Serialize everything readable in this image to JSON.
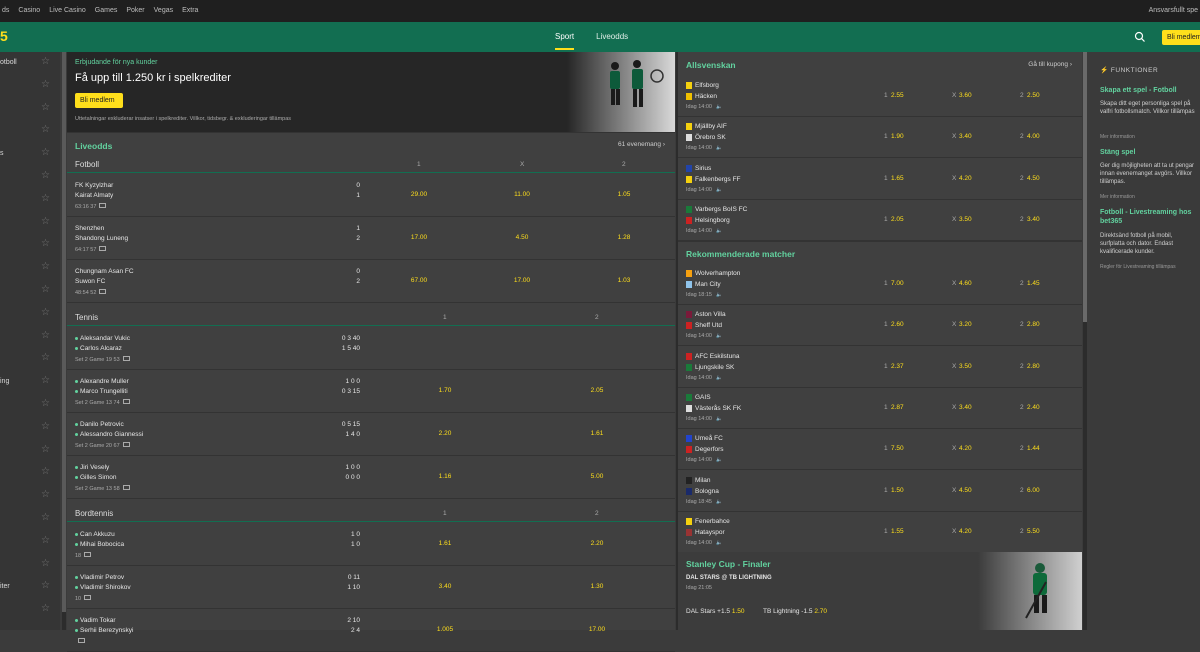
{
  "topbar": {
    "links": [
      "ds",
      "Casino",
      "Live Casino",
      "Games",
      "Poker",
      "Vegas",
      "Extra"
    ],
    "responsible": "Ansvarsfullt spe"
  },
  "header": {
    "logo": "5",
    "nav": [
      "Sport",
      "Liveodds"
    ],
    "join": "Bli medlem"
  },
  "sidebar": {
    "items": [
      "otboll",
      "",
      "",
      "",
      "s",
      "",
      "",
      "",
      "",
      "",
      "",
      "",
      "",
      "",
      "ing",
      "",
      "",
      "",
      "",
      "",
      "",
      "",
      "",
      "iter",
      ""
    ]
  },
  "promo": {
    "pre": "Erbjudande för nya kunder",
    "title": "Få upp till 1.250 kr i spelkrediter",
    "button": "Bli medlem",
    "legal": "Uttetalningar exkluderar insatser i spelkrediter. Villkor, tidsbegr. & exkluderingar tillämpas"
  },
  "liveodds": {
    "title": "Liveodds",
    "count": "61 evenemang",
    "groups": [
      {
        "name": "Fotboll",
        "cols": [
          "1",
          "X",
          "2"
        ],
        "rows": [
          {
            "t1": "FK Kyzylzhar",
            "t2": "Kairat Almaty",
            "s1": "0",
            "s2": "1",
            "meta": "63:16  37",
            "odds": [
              "29.00",
              "11.00",
              "1.05"
            ]
          },
          {
            "t1": "Shenzhen",
            "t2": "Shandong Luneng",
            "s1": "1",
            "s2": "2",
            "meta": "64:17  57",
            "odds": [
              "17.00",
              "4.50",
              "1.28"
            ]
          },
          {
            "t1": "Chungnam Asan FC",
            "t2": "Suwon FC",
            "s1": "0",
            "s2": "2",
            "meta": "48:54  52",
            "odds": [
              "67.00",
              "17.00",
              "1.03"
            ]
          }
        ]
      },
      {
        "name": "Tennis",
        "cols": [
          "1",
          "2"
        ],
        "rows": [
          {
            "t1": "Aleksandar Vukic",
            "t2": "Carlos Alcaraz",
            "s1": "0  3  40",
            "s2": "1  5  40",
            "meta": "Set 2 Game 19  53",
            "odds": [
              "",
              ""
            ]
          },
          {
            "t1": "Alexandre Muller",
            "t2": "Marco Trungelliti",
            "s1": "1  0  0",
            "s2": "0  3  15",
            "meta": "Set 2 Game 13  74",
            "odds": [
              "1.70",
              "2.05"
            ]
          },
          {
            "t1": "Danilo Petrovic",
            "t2": "Alessandro Giannessi",
            "s1": "0  5  15",
            "s2": "1  4  0",
            "meta": "Set 2 Game 20  67",
            "odds": [
              "2.20",
              "1.61"
            ]
          },
          {
            "t1": "Jiri Vesely",
            "t2": "Gilles Simon",
            "s1": "1  0  0",
            "s2": "0  0  0",
            "meta": "Set 2 Game 13  58",
            "odds": [
              "1.16",
              "5.00"
            ]
          }
        ]
      },
      {
        "name": "Bordtennis",
        "cols": [
          "1",
          "2"
        ],
        "rows": [
          {
            "t1": "Can Akkuzu",
            "t2": "Mihai Bobocica",
            "s1": "1  0",
            "s2": "1  0",
            "meta": "18",
            "odds": [
              "1.61",
              "2.20"
            ]
          },
          {
            "t1": "Vladimir Petrov",
            "t2": "Vladimir Shirokov",
            "s1": "0  11",
            "s2": "1  10",
            "meta": "10",
            "odds": [
              "3.40",
              "1.30"
            ]
          },
          {
            "t1": "Vadim Tokar",
            "t2": "Serhii Berezynskyi",
            "s1": "2  10",
            "s2": "2  4",
            "meta": "",
            "odds": [
              "1.005",
              "17.00"
            ]
          }
        ]
      }
    ]
  },
  "allsvenskan": {
    "title": "Allsvenskan",
    "link": "Gå till kupong",
    "matches": [
      {
        "t1": "Elfsborg",
        "t2": "Häcken",
        "time": "Idag 14:00",
        "k1": "#f5d10f",
        "k2": "#f0c000",
        "o": [
          "2.55",
          "3.60",
          "2.50"
        ]
      },
      {
        "t1": "Mjällby AIF",
        "t2": "Örebro SK",
        "time": "Idag 14:00",
        "k1": "#f5d10f",
        "k2": "#ddd",
        "o": [
          "1.90",
          "3.40",
          "4.00"
        ]
      },
      {
        "t1": "Sirius",
        "t2": "Falkenbergs FF",
        "time": "Idag 14:00",
        "k1": "#2244aa",
        "k2": "#f5d10f",
        "o": [
          "1.65",
          "4.20",
          "4.50"
        ]
      },
      {
        "t1": "Varbergs BoIS FC",
        "t2": "Helsingborg",
        "time": "Idag 14:00",
        "k1": "#1a7a3a",
        "k2": "#cc2222",
        "o": [
          "2.05",
          "3.50",
          "3.40"
        ]
      }
    ]
  },
  "rekommenderade": {
    "title": "Rekommenderade matcher",
    "matches": [
      {
        "t1": "Wolverhampton",
        "t2": "Man City",
        "time": "Idag 18:15",
        "k1": "#f5a010",
        "k2": "#8fc3ea",
        "o": [
          "7.00",
          "4.60",
          "1.45"
        ]
      },
      {
        "t1": "Aston Villa",
        "t2": "Sheff Utd",
        "time": "Idag 14:00",
        "k1": "#7a1a3a",
        "k2": "#cc2222",
        "o": [
          "2.60",
          "3.20",
          "2.80"
        ]
      },
      {
        "t1": "AFC Eskilstuna",
        "t2": "Ljungskile SK",
        "time": "Idag 14:00",
        "k1": "#cc2222",
        "k2": "#1a7a3a",
        "o": [
          "2.37",
          "3.50",
          "2.80"
        ]
      },
      {
        "t1": "GAIS",
        "t2": "Västerås SK FK",
        "time": "Idag 14:00",
        "k1": "#1a7a3a",
        "k2": "#ddd",
        "o": [
          "2.87",
          "3.40",
          "2.40"
        ]
      },
      {
        "t1": "Umeå FC",
        "t2": "Degerfors",
        "time": "Idag 14:00",
        "k1": "#2244cc",
        "k2": "#cc2222",
        "o": [
          "7.50",
          "4.20",
          "1.44"
        ]
      },
      {
        "t1": "Milan",
        "t2": "Bologna",
        "time": "Idag 18:45",
        "k1": "#222",
        "k2": "#1a2a6a",
        "o": [
          "1.50",
          "4.50",
          "6.00"
        ]
      },
      {
        "t1": "Fenerbahce",
        "t2": "Hatayspor",
        "time": "Idag 14:00",
        "k1": "#f5d10f",
        "k2": "#993333",
        "o": [
          "1.55",
          "4.20",
          "5.50"
        ]
      }
    ]
  },
  "stanley": {
    "title": "Stanley Cup - Finaler",
    "match": "DAL STARS @ TB LIGHTNING",
    "time": "Idag 21:05",
    "l1": "DAL Stars +1.5",
    "v1": "1.50",
    "l2": "TB Lightning -1.5",
    "v2": "2.70"
  },
  "features": {
    "heading": "FUNKTIONER",
    "items": [
      {
        "title": "Skapa ett spel - Fotboll",
        "desc": "Skapa ditt eget personliga spel på valfri fotbollsmatch. Villkor tillämpas",
        "more": "Mer information"
      },
      {
        "title": "Stäng spel",
        "desc": "Ger dig möjligheten att ta ut pengar innan evenemanget avgörs. Villkor tillämpas.",
        "more": "Mer information"
      },
      {
        "title": "Fotboll - Livestreaming hos bet365",
        "desc": "Direktsänd fotboll på mobil, surfplatta och dator. Endast kvalificerade kunder.",
        "more": "Regler för Livestreaming tillämpas"
      }
    ]
  },
  "colors": {
    "brand": "#126e51",
    "accent": "#ffdf1b",
    "link": "#62d29f"
  }
}
